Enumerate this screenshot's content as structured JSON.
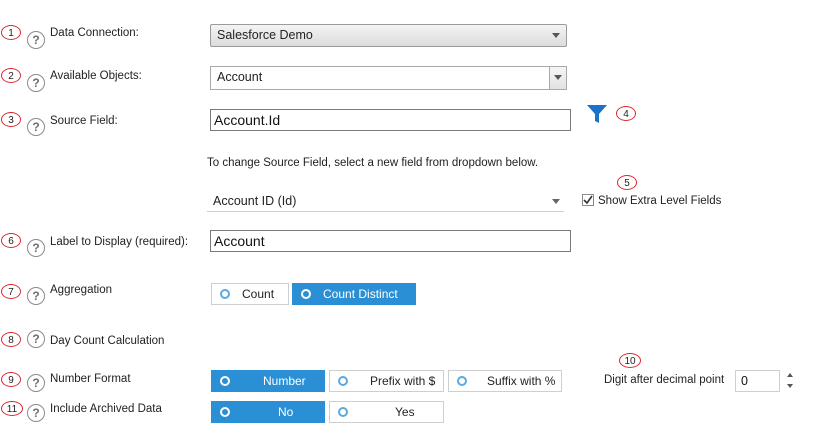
{
  "markers": [
    "1",
    "2",
    "3",
    "4",
    "5",
    "6",
    "7",
    "8",
    "9",
    "10",
    "11"
  ],
  "help_glyph": "?",
  "labels": {
    "data_connection": "Data Connection:",
    "available_objects": "Available Objects:",
    "source_field": "Source Field:",
    "label_to_display": "Label to Display (required):",
    "aggregation": "Aggregation",
    "day_count": "Day Count Calculation",
    "number_format": "Number Format",
    "include_archived": "Include Archived Data"
  },
  "data_connection": {
    "value": "Salesforce Demo"
  },
  "available_objects": {
    "value": "Account"
  },
  "source_field": {
    "value": "Account.Id",
    "filter_icon": "funnel-filter-icon",
    "filter_color": "#1a73c9"
  },
  "source_hint": "To change Source Field, select a new field from dropdown below.",
  "field_dropdown": {
    "value": "Account ID (Id)"
  },
  "show_extra": {
    "label": "Show Extra Level Fields",
    "checked": true
  },
  "label_display": {
    "value": "Account"
  },
  "aggregation": {
    "options": [
      "Count",
      "Count Distinct"
    ],
    "selected": "Count Distinct"
  },
  "number_format": {
    "options": [
      "Number",
      "Prefix with $",
      "Suffix with %"
    ],
    "selected": "Number"
  },
  "digits": {
    "label": "Digit after decimal point",
    "value": "0"
  },
  "archived": {
    "options": [
      "No",
      "Yes"
    ],
    "selected": "No"
  },
  "colors": {
    "accent": "#2a8fd4",
    "marker_border": "#d9272e"
  }
}
